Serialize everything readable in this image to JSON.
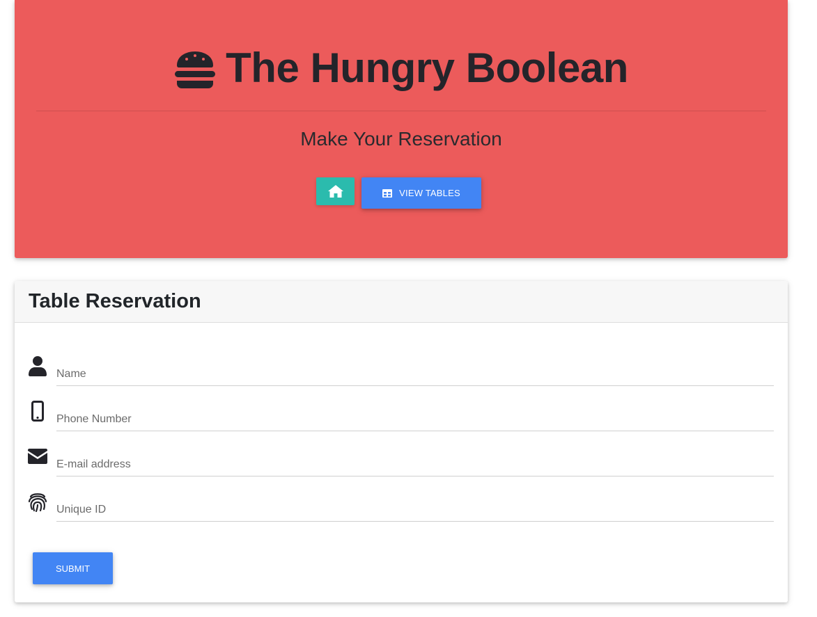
{
  "header": {
    "brand_icon": "hamburger-icon",
    "title": "The Hungry Boolean",
    "subtitle": "Make Your Reservation",
    "home_button": {
      "icon": "home-icon"
    },
    "view_tables_button": {
      "icon": "table-icon",
      "label": "VIEW TABLES"
    }
  },
  "form": {
    "title": "Table Reservation",
    "fields": [
      {
        "icon": "user-icon",
        "placeholder": "Name",
        "value": ""
      },
      {
        "icon": "mobile-phone-icon",
        "placeholder": "Phone Number",
        "value": ""
      },
      {
        "icon": "envelope-icon",
        "placeholder": "E-mail address",
        "value": ""
      },
      {
        "icon": "fingerprint-icon",
        "placeholder": "Unique ID",
        "value": ""
      }
    ],
    "submit_label": "SUBMIT"
  },
  "colors": {
    "header_bg": "#ec5b5b",
    "home_button": "#2bbbad",
    "primary_button": "#4285f4",
    "text_dark": "#24242a"
  }
}
